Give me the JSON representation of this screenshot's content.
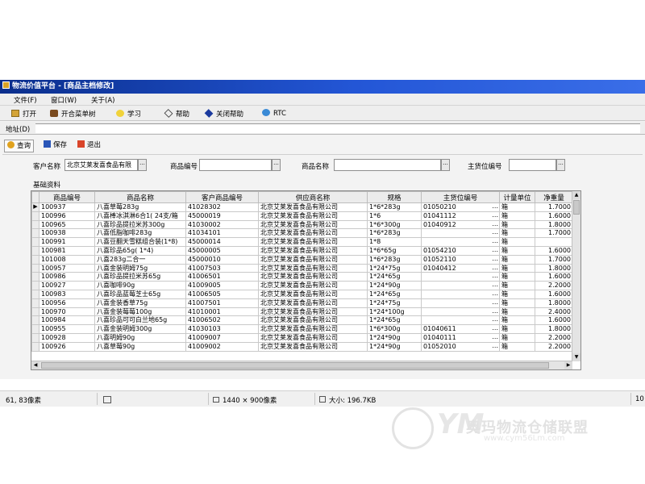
{
  "window": {
    "title": "物流价值平台 - [商品主档修改]"
  },
  "menu": [
    "文件(F)",
    "窗口(W)",
    "关于(A)"
  ],
  "toolbar": [
    "打开",
    "开合菜单树",
    "学习",
    "帮助",
    "关闭帮助",
    "RTC"
  ],
  "address": {
    "label": "地址(D)",
    "value": ""
  },
  "form_toolbar": [
    "查询",
    "保存",
    "退出"
  ],
  "filters": {
    "customer_label": "客户名称",
    "customer_value": "北京艾莱发喜食品有限",
    "product_code_label": "商品编号",
    "product_code_value": "",
    "product_name_label": "商品名称",
    "product_name_value": "",
    "location_label": "主货位编号",
    "location_value": "",
    "dropdown_glyph": "..."
  },
  "section_label": "基础资料",
  "grid": {
    "columns": [
      "商品编号",
      "商品名称",
      "客户商品编号",
      "供应商名称",
      "规格",
      "主货位编号",
      "计量单位",
      "净重量"
    ],
    "rows": [
      [
        "100937",
        "八喜草莓283g",
        "41028302",
        "北京艾莱发喜食品有限公司",
        "1*6*283g",
        "01050210",
        "箱",
        "1.7000"
      ],
      [
        "100996",
        "八喜棒冰淇淋6合1( 24支/箱",
        "45000019",
        "北京艾莱发喜食品有限公司",
        "1*6",
        "01041112",
        "箱",
        "1.6000"
      ],
      [
        "100965",
        "八喜珍品提拉米苏300g",
        "41030002",
        "北京艾莱发喜食品有限公司",
        "1*6*300g",
        "01040912",
        "箱",
        "1.8000"
      ],
      [
        "100938",
        "八喜低脂咖啡283g",
        "41034101",
        "北京艾莱发喜食品有限公司",
        "1*6*283g",
        "",
        "箱",
        "1.7000"
      ],
      [
        "100991",
        "八喜豆翻天雪糕组合装(1*8)",
        "45000014",
        "北京艾莱发喜食品有限公司",
        "1*8",
        "",
        "箱",
        ""
      ],
      [
        "100981",
        "八喜珍品65g( 1*4)",
        "45000005",
        "北京艾莱发喜食品有限公司",
        "1*6*65g",
        "01054210",
        "箱",
        "1.6000"
      ],
      [
        "101008",
        "八喜283g二合一",
        "45000010",
        "北京艾莱发喜食品有限公司",
        "1*6*283g",
        "01052110",
        "箱",
        "1.7000"
      ],
      [
        "100957",
        "八喜金装明姆75g",
        "41007503",
        "北京艾莱发喜食品有限公司",
        "1*24*75g",
        "01040412",
        "箱",
        "1.8000"
      ],
      [
        "100986",
        "八喜珍品提拉米苏65g",
        "41006501",
        "北京艾莱发喜食品有限公司",
        "1*24*65g",
        "",
        "箱",
        "1.6000"
      ],
      [
        "100927",
        "八喜咖啡90g",
        "41009005",
        "北京艾莱发喜食品有限公司",
        "1*24*90g",
        "",
        "箱",
        "2.2000"
      ],
      [
        "100983",
        "八喜珍品蓝莓芝士65g",
        "41006505",
        "北京艾莱发喜食品有限公司",
        "1*24*65g",
        "",
        "箱",
        "1.6000"
      ],
      [
        "100956",
        "八喜金装香草75g",
        "41007501",
        "北京艾莱发喜食品有限公司",
        "1*24*75g",
        "",
        "箱",
        "1.8000"
      ],
      [
        "100970",
        "八喜金装莓莓100g",
        "41010001",
        "北京艾莱发喜食品有限公司",
        "1*24*100g",
        "",
        "箱",
        "2.4000"
      ],
      [
        "100984",
        "八喜珍品可可白兰地65g",
        "41006502",
        "北京艾莱发喜食品有限公司",
        "1*24*65g",
        "",
        "箱",
        "1.6000"
      ],
      [
        "100955",
        "八喜金装明姆300g",
        "41030103",
        "北京艾莱发喜食品有限公司",
        "1*6*300g",
        "01040611",
        "箱",
        "1.8000"
      ],
      [
        "100928",
        "八喜明姆90g",
        "41009007",
        "北京艾莱发喜食品有限公司",
        "1*24*90g",
        "01040111",
        "箱",
        "2.2000"
      ],
      [
        "100926",
        "八喜草莓90g",
        "41009002",
        "北京艾莱发喜食品有限公司",
        "1*24*90g",
        "01052010",
        "箱",
        "2.2000"
      ]
    ],
    "row_marker": "▶",
    "cell_ellipsis": "..."
  },
  "status": {
    "coords": "61, 83像素",
    "dimensions": "1440 × 900像素",
    "size": "大小: 196.7KB",
    "zoom_partial": "10"
  },
  "watermark": {
    "logo_text": "YM",
    "title": "奥玛物流仓储联盟",
    "url": "www.cym56Lm.com"
  },
  "colors": {
    "titlebar": "#0a2e8c",
    "grid_border": "#c9c9c9"
  }
}
